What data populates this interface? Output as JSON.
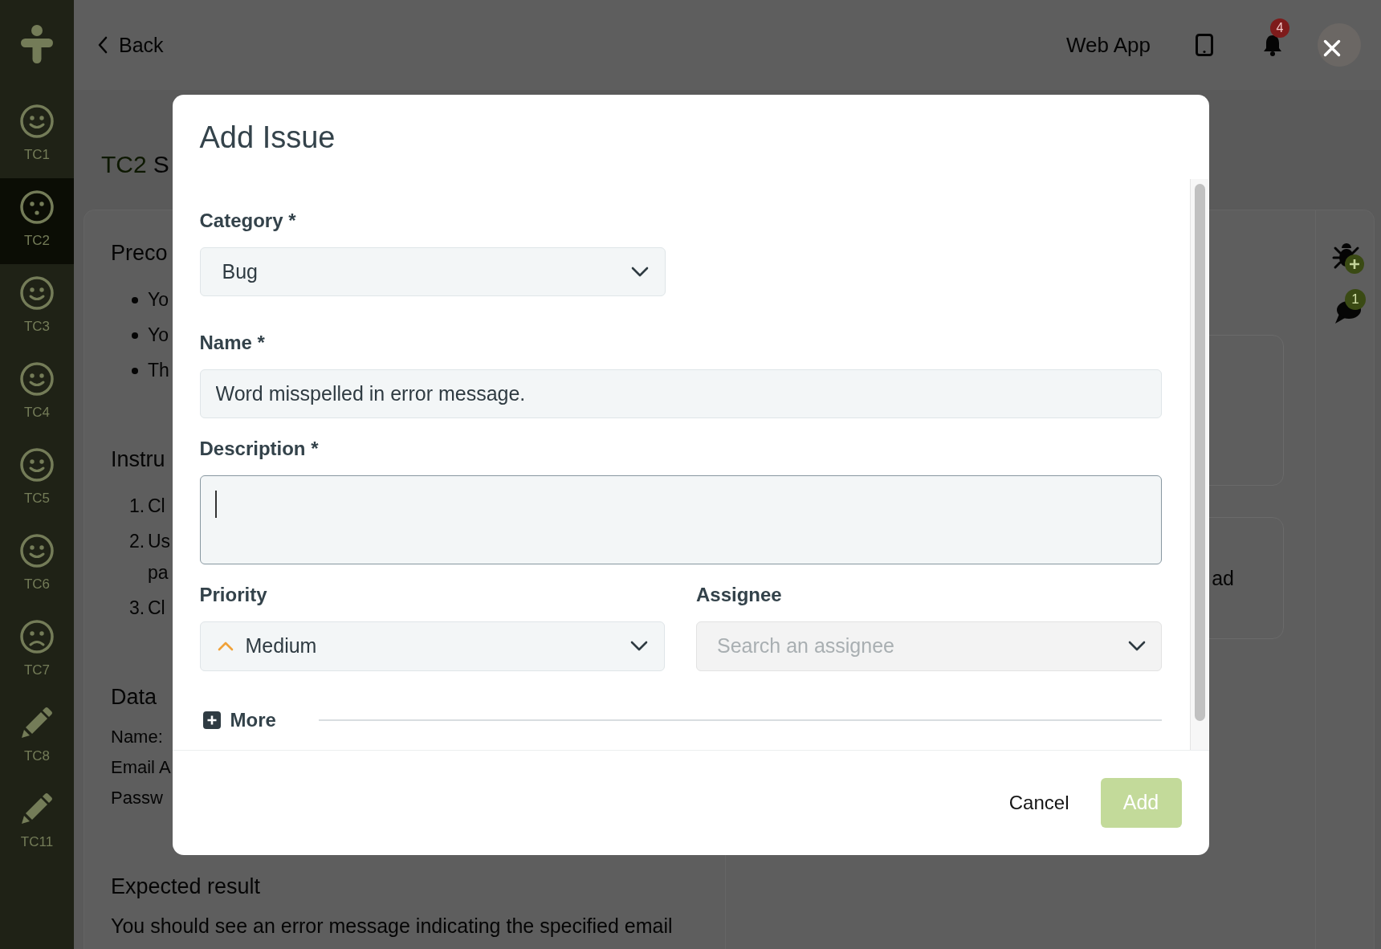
{
  "sidebar": {
    "items": [
      {
        "label": "TC1",
        "kind": "smile",
        "selected": false
      },
      {
        "label": "TC2",
        "kind": "neutral",
        "selected": true
      },
      {
        "label": "TC3",
        "kind": "smile",
        "selected": false
      },
      {
        "label": "TC4",
        "kind": "smile",
        "selected": false
      },
      {
        "label": "TC5",
        "kind": "smile",
        "selected": false
      },
      {
        "label": "TC6",
        "kind": "smile",
        "selected": false
      },
      {
        "label": "TC7",
        "kind": "frown",
        "selected": false
      },
      {
        "label": "TC8",
        "kind": "pencil",
        "selected": false
      },
      {
        "label": "TC11",
        "kind": "pencil",
        "selected": false
      }
    ]
  },
  "top_bar": {
    "back": "Back",
    "app_name": "Web App",
    "notification_count": "4"
  },
  "page": {
    "title_code": "TC2",
    "title": "S",
    "sections": [
      {
        "heading": "Preco",
        "kind": "bullets",
        "items": [
          {
            "lines": [
              "Yo"
            ]
          },
          {
            "lines": [
              "Yo"
            ]
          },
          {
            "lines": [
              "Th"
            ]
          }
        ]
      },
      {
        "heading": "Instru",
        "kind": "numbered",
        "items": [
          {
            "number": "1.",
            "lines": [
              "Cl"
            ]
          },
          {
            "number": "2.",
            "lines": [
              "Us",
              "pa"
            ]
          },
          {
            "number": "3.",
            "lines": [
              "Cl"
            ]
          }
        ]
      },
      {
        "heading": "Data",
        "kind": "lines",
        "lines": [
          "Name:",
          "Email A",
          "Passw"
        ]
      },
      {
        "heading": "Expected result",
        "kind": "paragraph",
        "text": "You should see an error message indicating the specified email"
      }
    ]
  },
  "side_panel": {
    "card_text": "ad"
  },
  "side_actions": {
    "comment_count": "1"
  },
  "modal": {
    "title": "Add Issue",
    "category": {
      "label": "Category *",
      "value": "Bug"
    },
    "name": {
      "label": "Name *",
      "value": "Word misspelled in error message."
    },
    "description": {
      "label": "Description *",
      "focused": true
    },
    "priority": {
      "label": "Priority",
      "value": "Medium"
    },
    "assignee": {
      "label": "Assignee",
      "placeholder": "Search an assignee"
    },
    "more": "More",
    "cancel": "Cancel",
    "add": {
      "label": "Add",
      "disabled": true
    }
  }
}
